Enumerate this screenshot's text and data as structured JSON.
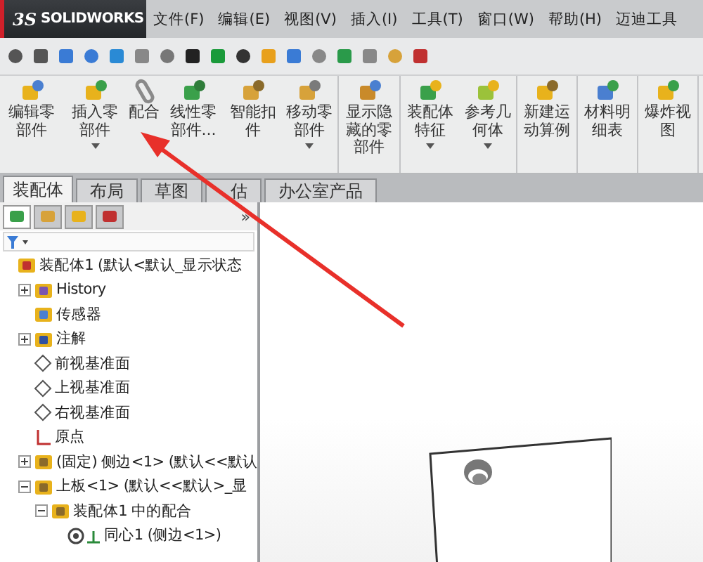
{
  "app": {
    "logo_mark": "3S",
    "logo_text": "SOLIDWORKS"
  },
  "menu": [
    "文件(F)",
    "编辑(E)",
    "视图(V)",
    "插入(I)",
    "工具(T)",
    "窗口(W)",
    "帮助(H)",
    "迈迪工具"
  ],
  "command_groups": [
    [
      {
        "label": "编辑零部件",
        "dropdown": false
      },
      {
        "label": "插入零部件",
        "dropdown": true
      },
      {
        "label": "配合",
        "dropdown": false
      },
      {
        "label": "线性零部件...",
        "dropdown": false
      },
      {
        "label": "智能扣件",
        "dropdown": false
      },
      {
        "label": "移动零部件",
        "dropdown": true
      }
    ],
    [
      {
        "label": "显示隐藏的零部件",
        "dropdown": false
      }
    ],
    [
      {
        "label": "装配体特征",
        "dropdown": true
      },
      {
        "label": "参考几何体",
        "dropdown": true
      }
    ],
    [
      {
        "label": "新建运动算例",
        "dropdown": false
      }
    ],
    [
      {
        "label": "材料明细表",
        "dropdown": false
      }
    ],
    [
      {
        "label": "爆炸视图",
        "dropdown": false
      }
    ]
  ],
  "tabs": [
    {
      "label": "装配体",
      "selected": true
    },
    {
      "label": "布局",
      "selected": false
    },
    {
      "label": "草图",
      "selected": false
    },
    {
      "label": "估",
      "selected": false
    },
    {
      "label": "办公室产品",
      "selected": false
    }
  ],
  "panel_tabs": [
    {
      "selected": true
    },
    {
      "selected": false
    },
    {
      "selected": false
    },
    {
      "selected": false
    }
  ],
  "panel_more": "»",
  "tree": [
    {
      "label": "装配体1  (默认<默认_显示状态",
      "kind": "assembly",
      "children": [
        {
          "label": "History",
          "kind": "history",
          "expanded": false
        },
        {
          "label": "传感器",
          "kind": "sensor"
        },
        {
          "label": "注解",
          "kind": "annotation",
          "expanded": false
        },
        {
          "label": "前视基准面",
          "kind": "plane"
        },
        {
          "label": "上视基准面",
          "kind": "plane"
        },
        {
          "label": "右视基准面",
          "kind": "plane"
        },
        {
          "label": "原点",
          "kind": "origin"
        },
        {
          "label": "(固定) 侧边<1> (默认<<默认",
          "kind": "part",
          "expanded": false
        },
        {
          "label": "上板<1> (默认<<默认>_显",
          "kind": "part",
          "expanded": true,
          "children": [
            {
              "label": "装配体1 中的配合",
              "kind": "mates",
              "expanded": true,
              "children": [
                {
                  "label": "同心1 (侧边<1>)",
                  "kind": "mate"
                }
              ]
            }
          ]
        }
      ]
    }
  ]
}
